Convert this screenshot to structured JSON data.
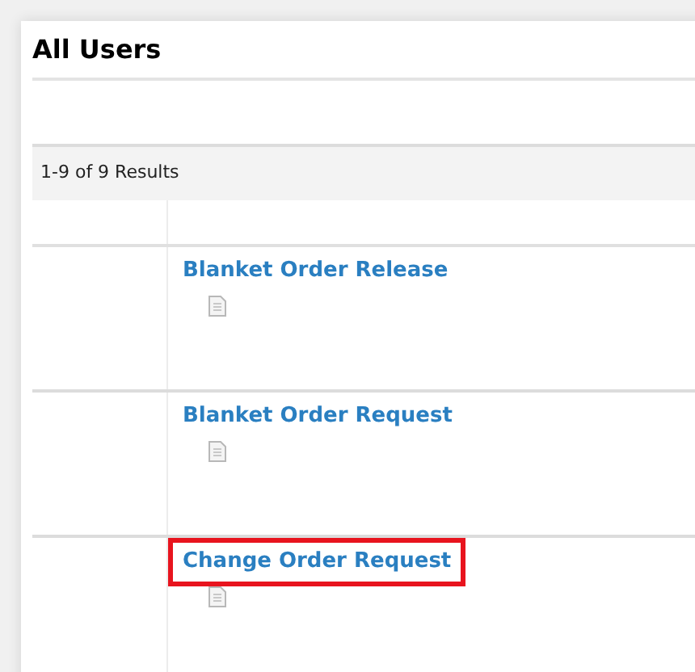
{
  "title": "All Users",
  "results_summary": "1-9 of 9 Results",
  "rows": [
    {
      "link": "Blanket Order Release",
      "highlighted": false
    },
    {
      "link": "Blanket Order Request",
      "highlighted": false
    },
    {
      "link": "Change Order Request",
      "highlighted": true
    }
  ]
}
